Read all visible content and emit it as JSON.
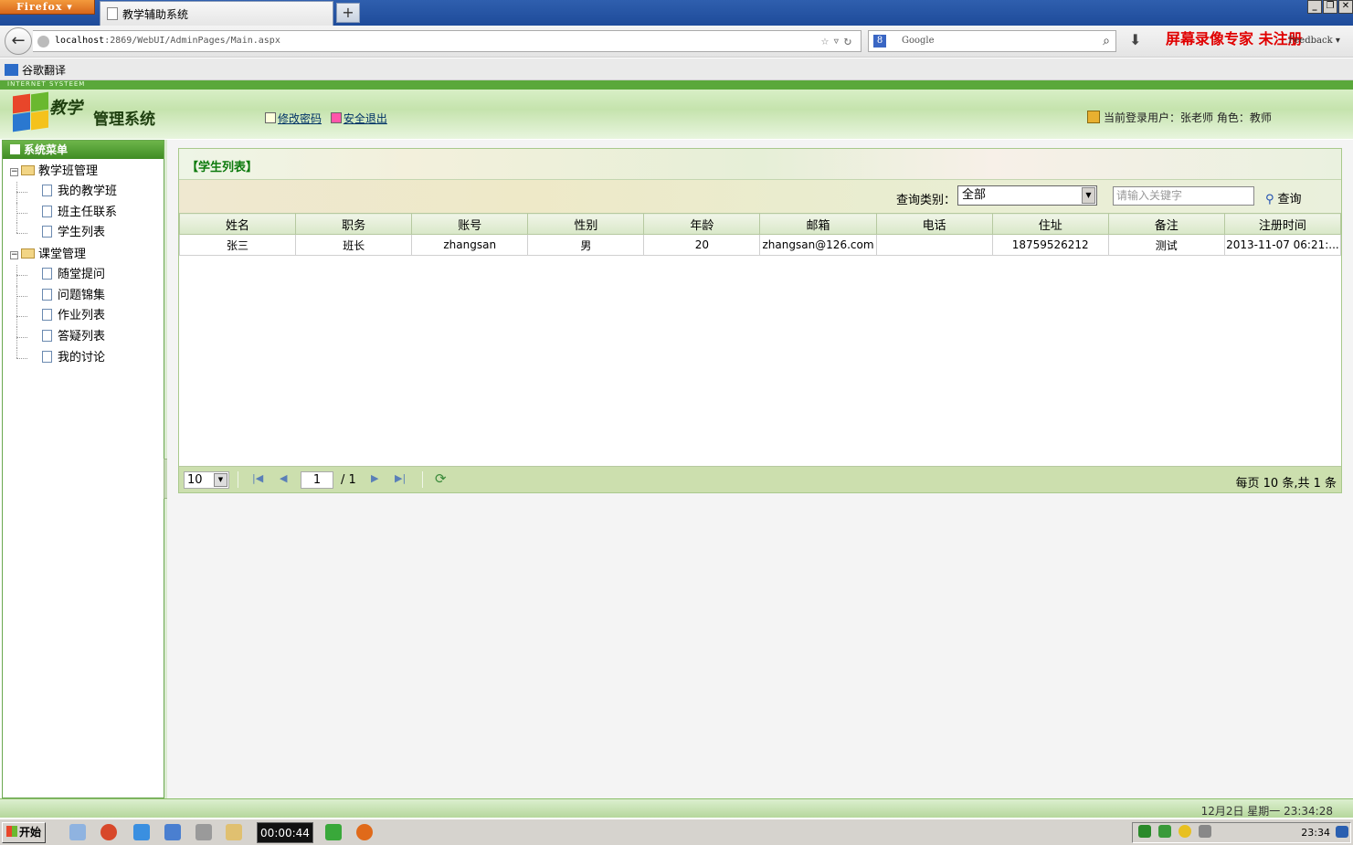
{
  "browser": {
    "app_button": "Firefox",
    "tab_title": "教学辅助系统",
    "new_tab": "+",
    "url_host": "localhost",
    "url_rest": ":2869/WebUI/AdminPages/Main.aspx",
    "search_placeholder": "Google",
    "feedback": "Feedback",
    "watermark": "屏幕录像专家 未注册",
    "bookmark": "谷歌翻译"
  },
  "header": {
    "banner_text": "INTERNET SYSTEEM",
    "logo_title_1": "教学",
    "logo_title_2": "管理系统",
    "links": [
      "修改密码",
      "安全退出"
    ],
    "user_info": "当前登录用户：张老师 角色：教师"
  },
  "sidebar": {
    "title": "系统菜单",
    "groups": [
      {
        "label": "教学班管理",
        "items": [
          "我的教学班",
          "班主任联系",
          "学生列表"
        ]
      },
      {
        "label": "课堂管理",
        "items": [
          "随堂提问",
          "问题锦集",
          "作业列表",
          "答疑列表",
          "我的讨论"
        ]
      }
    ]
  },
  "panel": {
    "title": "【学生列表】",
    "query_label": "查询类别：",
    "query_value": "全部",
    "keyword_placeholder": "请输入关键字",
    "search_button": "查询"
  },
  "table": {
    "columns": [
      "姓名",
      "职务",
      "账号",
      "性别",
      "年龄",
      "邮箱",
      "电话",
      "住址",
      "备注",
      "注册时间"
    ],
    "rows": [
      [
        "张三",
        "班长",
        "zhangsan",
        "男",
        "20",
        "zhangsan@126.com",
        "",
        "18759526212",
        "测试",
        "2013-11-07 06:21:..."
      ]
    ]
  },
  "pager": {
    "page_size": "10",
    "current_page": "1",
    "total_pages": "/ 1",
    "summary": "每页 10 条,共 1 条"
  },
  "statusbar": {
    "datetime": "12月2日 星期一 23:34:28"
  },
  "taskbar": {
    "start": "开始",
    "timer": "00:00:44",
    "clock": "23:34"
  },
  "colors": {
    "accent_green": "#5aa83a",
    "title_green": "#0d7a0d",
    "watermark_red": "#e00000"
  }
}
